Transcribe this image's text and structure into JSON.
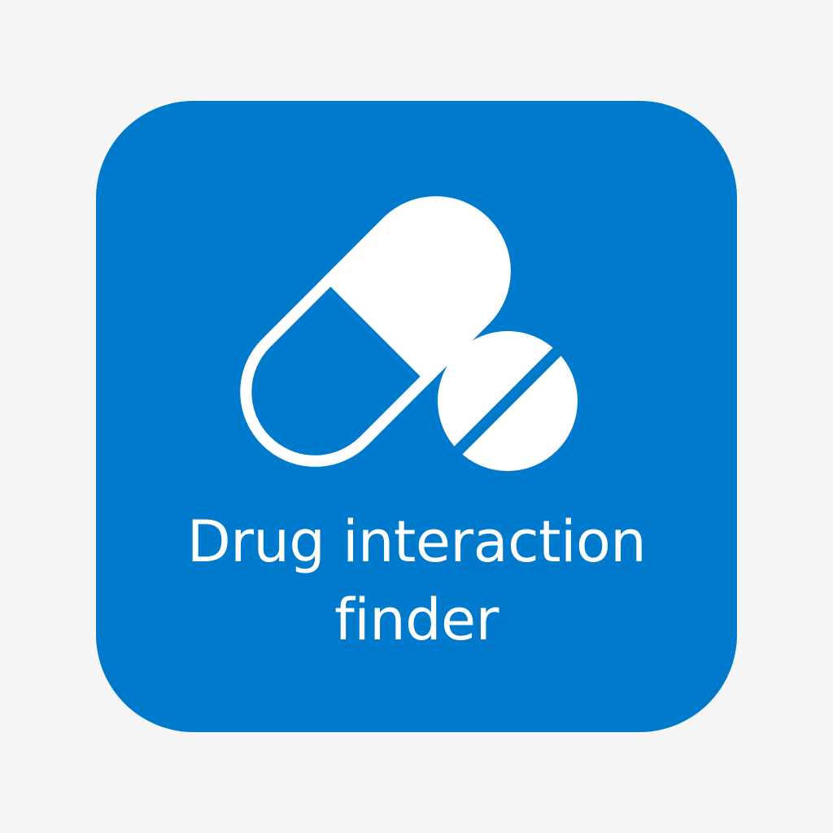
{
  "icon": {
    "background_color": "#007acc",
    "foreground_color": "#ffffff",
    "page_background": "#f5f5f5",
    "graphic": "capsule-and-tablet-icon"
  },
  "label": {
    "line1": "Drug interaction",
    "line2": "finder"
  }
}
